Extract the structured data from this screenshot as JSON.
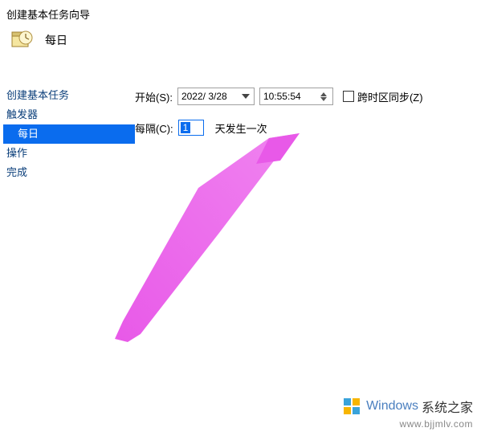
{
  "header": {
    "dialog_title": "创建基本任务向导",
    "page_title": "每日"
  },
  "sidebar": {
    "items": [
      {
        "label": "创建基本任务"
      },
      {
        "label": "触发器"
      },
      {
        "label": "每日"
      },
      {
        "label": "操作"
      },
      {
        "label": "完成"
      }
    ]
  },
  "form": {
    "start_label": "开始(S):",
    "date_value": "2022/ 3/28",
    "time_value": "10:55:54",
    "tz_label": "跨时区同步(Z)",
    "interval_label": "每隔(C):",
    "interval_value": "1",
    "interval_suffix": "天发生一次"
  },
  "watermark": {
    "brand": "Windows",
    "cn": "系统之家",
    "url": "www.bjjmlv.com"
  }
}
